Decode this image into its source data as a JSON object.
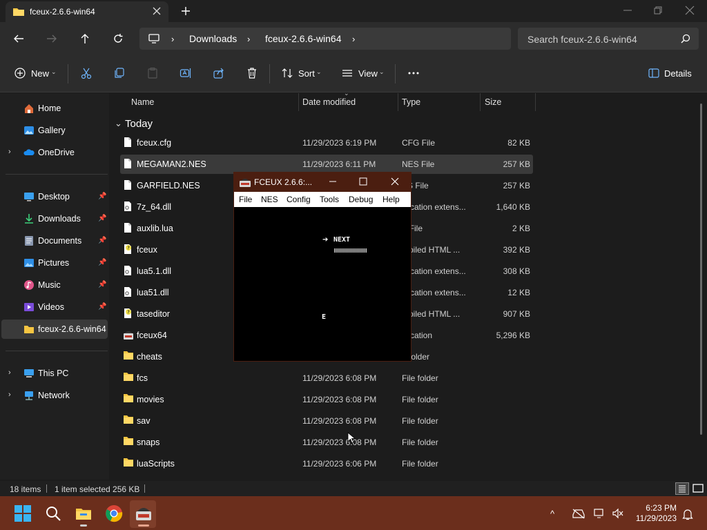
{
  "window": {
    "tab_title": "fceux-2.6.6-win64"
  },
  "nav": {
    "breadcrumbs": [
      "Downloads",
      "fceux-2.6.6-win64"
    ],
    "search_placeholder": "Search fceux-2.6.6-win64"
  },
  "commands": {
    "new": "New",
    "sort": "Sort",
    "view": "View",
    "details": "Details"
  },
  "sidebar": {
    "items": [
      {
        "label": "Home",
        "icon": "home-icon"
      },
      {
        "label": "Gallery",
        "icon": "gallery-icon"
      },
      {
        "label": "OneDrive",
        "icon": "onedrive-icon"
      },
      {
        "label": "Desktop",
        "icon": "desktop-icon",
        "pinned": true
      },
      {
        "label": "Downloads",
        "icon": "downloads-icon",
        "pinned": true
      },
      {
        "label": "Documents",
        "icon": "documents-icon",
        "pinned": true
      },
      {
        "label": "Pictures",
        "icon": "pictures-icon",
        "pinned": true
      },
      {
        "label": "Music",
        "icon": "music-icon",
        "pinned": true
      },
      {
        "label": "Videos",
        "icon": "videos-icon",
        "pinned": true
      },
      {
        "label": "fceux-2.6.6-win64",
        "icon": "folder-icon",
        "selected": true
      },
      {
        "label": "This PC",
        "icon": "this-pc-icon"
      },
      {
        "label": "Network",
        "icon": "network-icon"
      }
    ]
  },
  "columns": {
    "name": "Name",
    "date": "Date modified",
    "type": "Type",
    "size": "Size"
  },
  "group": {
    "label": "Today"
  },
  "files": [
    {
      "name": "fceux.cfg",
      "date": "11/29/2023 6:19 PM",
      "type": "CFG File",
      "size": "82 KB",
      "icon": "file-icon"
    },
    {
      "name": "MEGAMAN2.NES",
      "date": "11/29/2023 6:11 PM",
      "type": "NES File",
      "size": "257 KB",
      "icon": "file-icon",
      "selected": true
    },
    {
      "name": "GARFIELD.NES",
      "date": "",
      "type": "ES File",
      "size": "257 KB",
      "icon": "file-icon"
    },
    {
      "name": "7z_64.dll",
      "date": "",
      "type": "plication extens...",
      "size": "1,640 KB",
      "icon": "dll-icon"
    },
    {
      "name": "auxlib.lua",
      "date": "",
      "type": "A File",
      "size": "2 KB",
      "icon": "file-icon"
    },
    {
      "name": "fceux",
      "date": "",
      "type": "mpiled HTML ...",
      "size": "392 KB",
      "icon": "help-file-icon"
    },
    {
      "name": "lua5.1.dll",
      "date": "",
      "type": "plication extens...",
      "size": "308 KB",
      "icon": "dll-icon"
    },
    {
      "name": "lua51.dll",
      "date": "",
      "type": "plication extens...",
      "size": "12 KB",
      "icon": "dll-icon"
    },
    {
      "name": "taseditor",
      "date": "",
      "type": "mpiled HTML ...",
      "size": "907 KB",
      "icon": "help-file-icon"
    },
    {
      "name": "fceux64",
      "date": "",
      "type": "plication",
      "size": "5,296 KB",
      "icon": "fceux-app-icon"
    },
    {
      "name": "cheats",
      "date": "",
      "type": "e folder",
      "size": "",
      "icon": "folder-icon"
    },
    {
      "name": "fcs",
      "date": "11/29/2023 6:08 PM",
      "type": "File folder",
      "size": "",
      "icon": "folder-icon"
    },
    {
      "name": "movies",
      "date": "11/29/2023 6:08 PM",
      "type": "File folder",
      "size": "",
      "icon": "folder-icon"
    },
    {
      "name": "sav",
      "date": "11/29/2023 6:08 PM",
      "type": "File folder",
      "size": "",
      "icon": "folder-icon"
    },
    {
      "name": "snaps",
      "date": "11/29/2023 6:08 PM",
      "type": "File folder",
      "size": "",
      "icon": "folder-icon"
    },
    {
      "name": "luaScripts",
      "date": "11/29/2023 6:06 PM",
      "type": "File folder",
      "size": "",
      "icon": "folder-icon"
    }
  ],
  "status": {
    "count": "18 items",
    "selection": "1 item selected  256 KB"
  },
  "fceux_window": {
    "title": "FCEUX 2.6.6:...",
    "menu": [
      "File",
      "NES",
      "Config",
      "Tools",
      "Debug",
      "Help"
    ],
    "screen_next": "NEXT",
    "screen_letter": "E"
  },
  "taskbar": {
    "time": "6:23 PM",
    "date": "11/29/2023"
  },
  "colors": {
    "taskbar": "#6b2e1c",
    "fceux_titlebar": "#4b1e10",
    "folder": "#f5c542",
    "accent": "#4cc2ff"
  }
}
